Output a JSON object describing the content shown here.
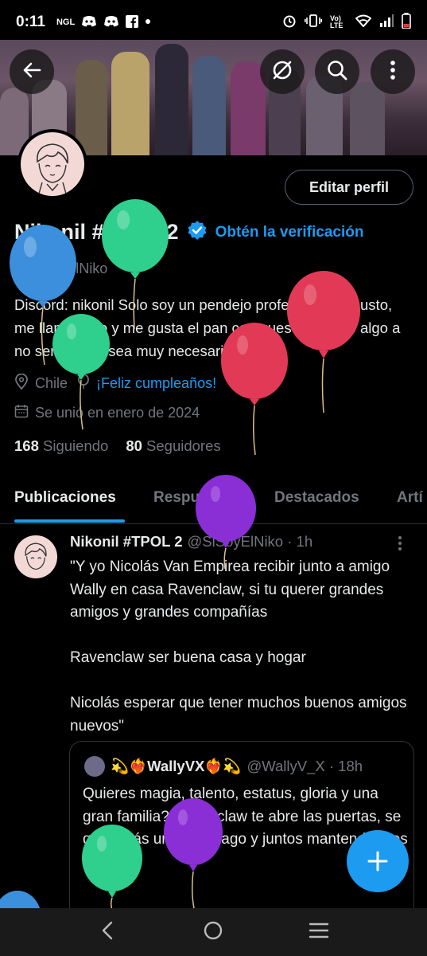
{
  "status_bar": {
    "time": "0:11",
    "left_icons": [
      "ngl-icon",
      "discord-icon",
      "discord-icon",
      "facebook-icon",
      "dot-icon"
    ],
    "ngl_label": "NGL",
    "right_icons": [
      "alarm-icon",
      "vibrate-icon",
      "volte-icon",
      "wifi-icon",
      "signal-icon",
      "battery-icon"
    ],
    "volte_label": "Vo) LTE"
  },
  "header": {
    "back_icon": "arrow-left-icon",
    "mute_icon": "slash-circle-icon",
    "search_icon": "search-icon",
    "more_icon": "more-vertical-icon"
  },
  "profile": {
    "edit_button": "Editar perfil",
    "name": "Nikonil #TPOL 2",
    "get_verified": "Obtén la verificación",
    "handle": "@SiSoyElNiko",
    "bio": "Discord: nikonil Solo soy un pendejo profesional un gusto, me llamo Niko y me gusta el pan con queso, no digo algo a no ser de que sea muy necesario",
    "location": "Chile",
    "birthday": "¡Feliz cumpleaños!",
    "joined": "Se unió en enero de 2024",
    "following_count": "168",
    "following_label": "Siguiendo",
    "followers_count": "80",
    "followers_label": "Seguidores"
  },
  "tabs": [
    "Publicaciones",
    "Respuestas",
    "Destacados",
    "Artí"
  ],
  "active_tab": 0,
  "post": {
    "author": "Nikonil #TPOL 2",
    "meta": "@SiSoyElNiko · 1h",
    "text": "\"Y yo Nicolás Van Empirea recibir junto a amigo Wally en casa Ravenclaw, si tu querer grandes amigos y grandes compañías\n\nRavenclaw ser buena casa y hogar\n\nNicolás esperar que tener muchos buenos amigos nuevos\"",
    "quote": {
      "author": "💫❤️‍🔥WallyVX❤️‍🔥💫",
      "meta": "@WallyV_X · 18h",
      "text": "Quieres magia, talento, estatus, gloria y una gran familia? Ravenclaw te abre las puertas, se que serás un gran mago y juntos mantendremos"
    }
  },
  "fab_icon": "plus-icon",
  "nav_bar": {
    "icons": [
      "back-nav-icon",
      "home-nav-icon",
      "recents-nav-icon"
    ]
  },
  "colors": {
    "accent": "#1d9bf0",
    "text": "#e7e9ea",
    "muted": "#71767b",
    "border": "#2f3336",
    "balloon_blue": "#3c8fdc",
    "balloon_green": "#2fcf8d",
    "balloon_red": "#e23a56",
    "balloon_purple": "#8a2fd6"
  }
}
